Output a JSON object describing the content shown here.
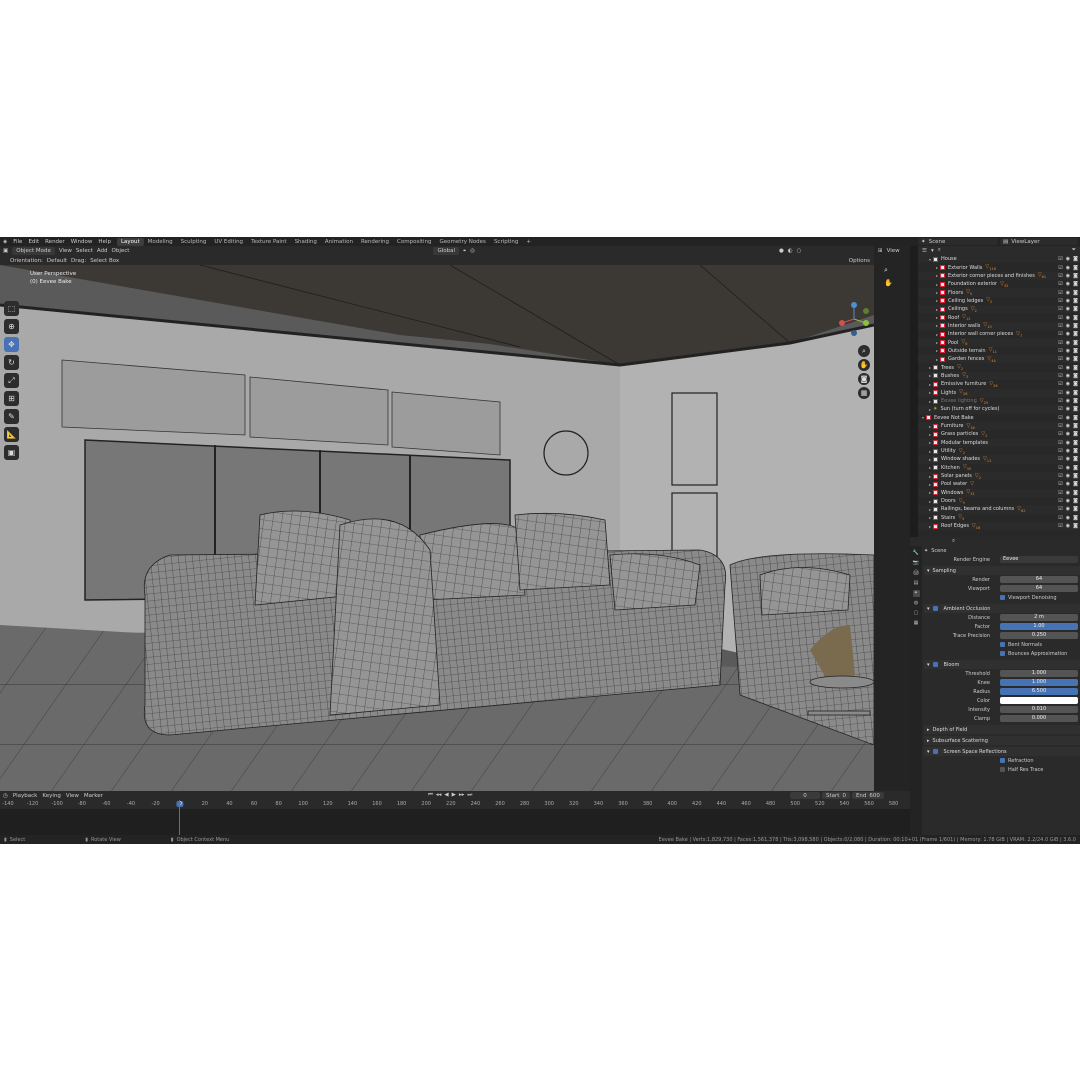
{
  "menu": [
    "File",
    "Edit",
    "Render",
    "Window",
    "Help"
  ],
  "workspaces": [
    "Layout",
    "Modeling",
    "Sculpting",
    "UV Editing",
    "Texture Paint",
    "Shading",
    "Animation",
    "Rendering",
    "Compositing",
    "Geometry Nodes",
    "Scripting"
  ],
  "active_workspace": "Layout",
  "scene_name": "Scene",
  "view_layer": "ViewLayer",
  "header": {
    "mode": "Object Mode",
    "view": "View",
    "select": "Select",
    "add": "Add",
    "object": "Object",
    "transform": "Global",
    "options": "Options"
  },
  "header2": {
    "orientation_label": "Orientation:",
    "orientation_value": "Default",
    "drag_label": "Drag:",
    "drag_value": "Select Box"
  },
  "viewport": {
    "perspective": "User Perspective",
    "collection": "(0) Eevee Bake"
  },
  "npanel": {
    "view_tab": "View"
  },
  "outliner": {
    "rows": [
      {
        "name": "House",
        "indent": 1,
        "open": true
      },
      {
        "name": "Exterior Walls",
        "indent": 2,
        "badge": "▽",
        "count": "116"
      },
      {
        "name": "Exterior corner pieces and finishes",
        "indent": 2,
        "badge": "▽",
        "count": "61"
      },
      {
        "name": "Foundation exterior",
        "indent": 2,
        "badge": "▽",
        "count": "32"
      },
      {
        "name": "Floors",
        "indent": 2,
        "badge": "▽",
        "count": "5"
      },
      {
        "name": "Ceiling ledges",
        "indent": 2,
        "badge": "▽",
        "count": "2"
      },
      {
        "name": "Ceilings",
        "indent": 2,
        "badge": "▽",
        "count": "2"
      },
      {
        "name": "Roof",
        "indent": 2,
        "badge": "▽",
        "count": "12"
      },
      {
        "name": "Interior walls",
        "indent": 2,
        "badge": "▽",
        "count": "10"
      },
      {
        "name": "Interior wall corner pieces",
        "indent": 2,
        "badge": "▽",
        "count": "7"
      },
      {
        "name": "Pool",
        "indent": 2,
        "badge": "▽",
        "count": "6"
      },
      {
        "name": "Outside terrain",
        "indent": 2,
        "badge": "▽",
        "count": "11"
      },
      {
        "name": "Garden fences",
        "indent": 2,
        "badge": "▽",
        "count": "44"
      },
      {
        "name": "Trees",
        "indent": 1,
        "badge": "▽",
        "count": "2"
      },
      {
        "name": "Bushes",
        "indent": 1,
        "badge": "▽",
        "count": "3"
      },
      {
        "name": "Emissive furniture",
        "indent": 1,
        "badge": "▽",
        "count": "26"
      },
      {
        "name": "Lights",
        "indent": 1,
        "badge": "▽",
        "count": "26"
      },
      {
        "name": "Eevee lighting",
        "indent": 1,
        "badge": "▽",
        "count": "29",
        "dim": true
      },
      {
        "name": "Sun (turn off for cycles)",
        "indent": 1,
        "sun": true
      },
      {
        "name": "Eevee Not Bake",
        "indent": 0,
        "open": true
      },
      {
        "name": "Furniture",
        "indent": 1,
        "badge": "▽",
        "count": "16"
      },
      {
        "name": "Grass particles",
        "indent": 1,
        "badge": "▽",
        "count": "2"
      },
      {
        "name": "Modular templates",
        "indent": 1
      },
      {
        "name": "Utility",
        "indent": 1,
        "badge": "▽",
        "count": "2"
      },
      {
        "name": "Window shades",
        "indent": 1,
        "badge": "▽",
        "count": "11"
      },
      {
        "name": "Kitchen",
        "indent": 1,
        "badge": "▽",
        "count": "30"
      },
      {
        "name": "Solar panels",
        "indent": 1,
        "badge": "▽",
        "count": "2"
      },
      {
        "name": "Pool water",
        "indent": 1,
        "badge": "▽"
      },
      {
        "name": "Windows",
        "indent": 1,
        "badge": "▽",
        "count": "31"
      },
      {
        "name": "Doors",
        "indent": 1,
        "badge": "▽",
        "count": "9"
      },
      {
        "name": "Railings, beams and columns",
        "indent": 1,
        "badge": "▽",
        "count": "62"
      },
      {
        "name": "Stairs",
        "indent": 1,
        "badge": "▽",
        "count": "5"
      },
      {
        "name": "Roof Edges",
        "indent": 1,
        "badge": "▽",
        "count": "16"
      }
    ]
  },
  "properties": {
    "context": "Scene",
    "render_engine_label": "Render Engine",
    "render_engine": "Eevee",
    "sampling": {
      "title": "Sampling",
      "render_label": "Render",
      "render": "64",
      "viewport_label": "Viewport",
      "viewport": "64",
      "denoise": "Viewport Denoising"
    },
    "ao": {
      "title": "Ambient Occlusion",
      "distance_label": "Distance",
      "distance": "2 m",
      "factor_label": "Factor",
      "factor": "1.00",
      "trace_label": "Trace Precision",
      "trace": "0.250",
      "bent": "Bent Normals",
      "bounces": "Bounces Approximation"
    },
    "bloom": {
      "title": "Bloom",
      "threshold_label": "Threshold",
      "threshold": "1.000",
      "knee_label": "Knee",
      "knee": "1.000",
      "radius_label": "Radius",
      "radius": "6.500",
      "color_label": "Color",
      "intensity_label": "Intensity",
      "intensity": "0.010",
      "clamp_label": "Clamp",
      "clamp": "0.000"
    },
    "dof": "Depth of Field",
    "sss": "Subsurface Scattering",
    "ssr": {
      "title": "Screen Space Reflections",
      "refraction": "Refraction",
      "half_res": "Half Res Trace"
    }
  },
  "timeline": {
    "playback": "Playback",
    "keying": "Keying",
    "view": "View",
    "marker": "Marker",
    "current": "0",
    "start_label": "Start",
    "start": "0",
    "end_label": "End",
    "end": "600",
    "ticks": [
      "-140",
      "-120",
      "-100",
      "-80",
      "-60",
      "-40",
      "-20",
      "0",
      "20",
      "40",
      "60",
      "80",
      "100",
      "120",
      "140",
      "160",
      "180",
      "200",
      "220",
      "240",
      "260",
      "280",
      "300",
      "320",
      "340",
      "360",
      "380",
      "400",
      "420",
      "440",
      "460",
      "480",
      "500",
      "520",
      "540",
      "560",
      "580"
    ]
  },
  "status": {
    "select": "Select",
    "rotate": "Rotate View",
    "context": "Object Context Menu",
    "stats": "Eevee Bake | Verts:1,829,730 | Faces:1,561,378 | Tris:3,098,580 | Objects:0/2,080 | Duration: 00:10+01 (Frame 1/601) | Memory: 1.78 GiB | VRAM: 2.2/24.0 GiB | 3.6.0"
  },
  "colors": {
    "accent": "#4772b3",
    "collection_red": "#d23a3a",
    "badge_orange": "#e8892a",
    "bg": "#1d1d1d"
  }
}
